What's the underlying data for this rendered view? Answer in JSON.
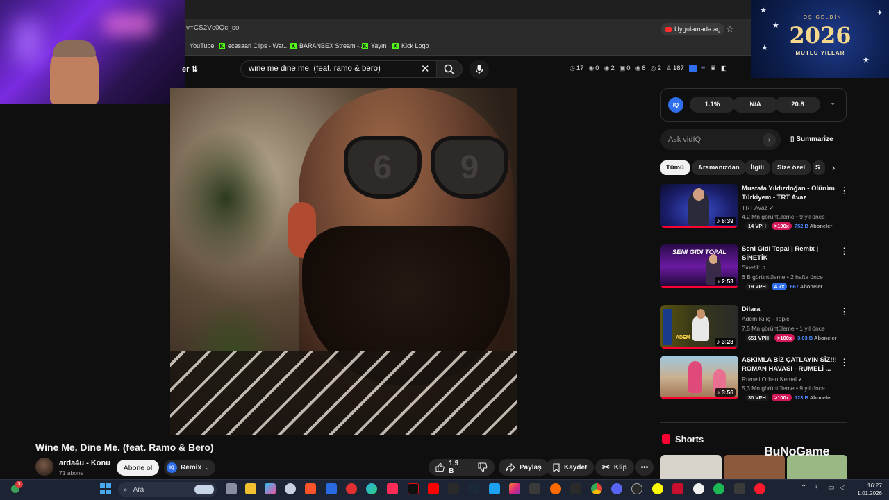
{
  "browser": {
    "url": "v=CS2Vc0Qc_so",
    "open_app": "Uygulamada aç",
    "bookmarks": [
      "YouTube",
      "ecesaari Clips - Wat...",
      "BARANBEX Stream -...",
      "Yayın",
      "Kick Logo"
    ]
  },
  "banner": {
    "welcome": "HOŞ GELDİN",
    "year": "2026",
    "subtitle": "MUTLU YILLAR"
  },
  "header": {
    "filter_label": "er",
    "search_value": "wine me dine me. (feat. ramo & bero)",
    "stats": [
      "17",
      "0",
      "2",
      "0",
      "8",
      "2",
      "187"
    ]
  },
  "video": {
    "title": "Wine Me, Dine Me. (feat. Ramo & Bero)",
    "channel": "arda4u - Konu",
    "subscribers": "71 abone",
    "subscribe_label": "Abone ol",
    "remix_label": "Remix",
    "like_count": "1,9 B",
    "share_label": "Paylaş",
    "save_label": "Kaydet",
    "clip_label": "Klip",
    "glasses_left": "6",
    "glasses_right": "9"
  },
  "vidiq": {
    "metrics": [
      "1.1%",
      "N/A",
      "20.8"
    ],
    "ask_placeholder": "Ask vidIQ",
    "summarize_label": "Summarize",
    "badge": "IQ"
  },
  "chips": [
    "Tümü",
    "Aramanızdan",
    "İlgili",
    "Size özel",
    "S"
  ],
  "recommendations": [
    {
      "title": "Mustafa Yıldızdoğan - Ölürüm Türkiyem - TRT Avaz",
      "channel": "TRT Avaz",
      "meta": "4,2 Mn görüntüleme • 9 yıl önce",
      "duration": "6:39",
      "vph": "14 VPH",
      "outlier": ">100x",
      "subs": "752 B",
      "subs_label": "Aboneler"
    },
    {
      "title": "Seni Gidi Topal | Remix | SİNETİK",
      "channel": "Sinetik ♬",
      "meta": "6 B görüntüleme • 2 hafta önce",
      "duration": "2:53",
      "vph": "19 VPH",
      "outlier": "4.7x",
      "subs": "667",
      "subs_label": "Aboneler",
      "thumb_text": "SENİ GİDİ TOPAL"
    },
    {
      "title": "Dilara",
      "channel": "Adem Kılıç - Topic",
      "meta": "7,5 Mn görüntüleme • 1 yıl önce",
      "duration": "3:28",
      "vph": "651 VPH",
      "outlier": ">100x",
      "subs": "3.03 B",
      "subs_label": "Aboneler",
      "thumb_text": "ADEM KILIÇ"
    },
    {
      "title": "AŞKIMLA BİZ ÇATLAYIN SİZ!!! ROMAN HAVASI - RUMELİ ...",
      "channel": "Rumeli Orhan Kemal",
      "meta": "5,3 Mn görüntüleme • 9 yıl önce",
      "duration": "3:56",
      "vph": "30 VPH",
      "outlier": ">100x",
      "subs": "123 B",
      "subs_label": "Aboneler"
    }
  ],
  "shorts": {
    "title": "Shorts",
    "watermark": "BuNoGame"
  },
  "taskbar": {
    "search_placeholder": "Ara",
    "time": "16:27",
    "date": "1.01.2026",
    "notif_count": "3"
  }
}
